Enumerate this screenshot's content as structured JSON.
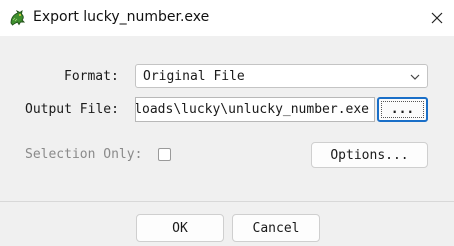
{
  "window": {
    "title": "Export lucky_number.exe",
    "app_icon": "dragon-icon",
    "close_icon": "close-icon"
  },
  "form": {
    "format_label": "Format:",
    "format_value": "Original File",
    "output_label": "Output File:",
    "output_value": "C:\\Users\\Downloads\\lucky\\unlucky_number.exe",
    "browse_label": "...",
    "selection_label": "Selection Only:",
    "selection_checked": false,
    "options_label": "Options..."
  },
  "footer": {
    "ok_label": "OK",
    "cancel_label": "Cancel"
  }
}
